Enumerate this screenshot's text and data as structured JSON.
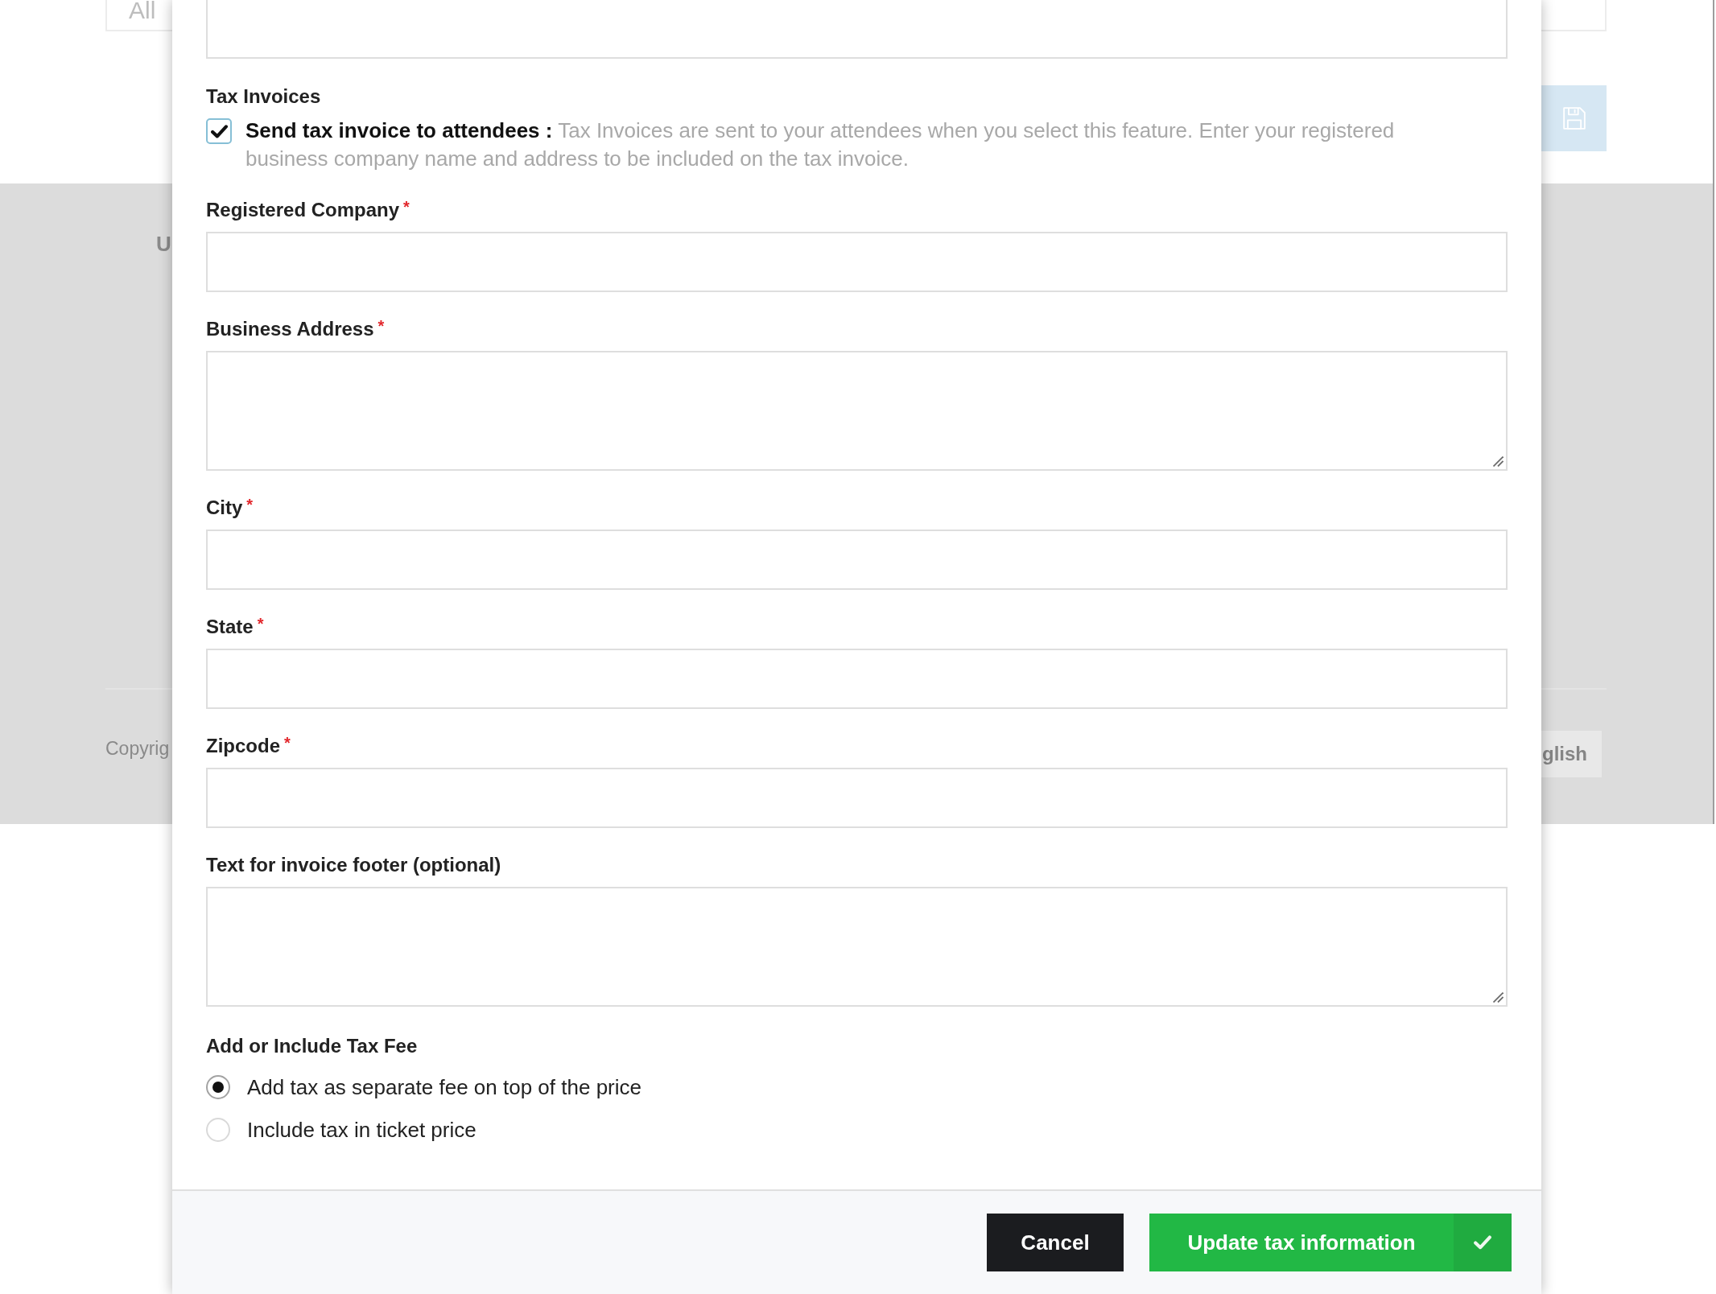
{
  "page": {
    "filter_field": {
      "placeholder": "All"
    },
    "side_heading": "U",
    "copyright": "Copyrig",
    "language_button": {
      "label": "glish"
    }
  },
  "modal": {
    "tax_invoices": {
      "heading": "Tax Invoices",
      "send_invoice": {
        "checked": true,
        "text": "**Send tax invoice to attendees :** Tax Invoices are sent to your attendees when you select this feature. Enter your registered business company name and address to be included on the tax invoice."
      }
    },
    "fields": [
      {
        "label": "Registered Company",
        "required_mark": "*",
        "kind": "input"
      },
      {
        "label": "Business Address",
        "required_mark": "*",
        "kind": "textarea"
      },
      {
        "label": "City",
        "required_mark": "*",
        "kind": "input"
      },
      {
        "label": "State",
        "required_mark": "*",
        "kind": "input"
      },
      {
        "label": "Zipcode",
        "required_mark": "*",
        "kind": "input"
      },
      {
        "label": "Text for invoice footer (optional)",
        "kind": "textarea"
      }
    ],
    "tax_fee": {
      "heading": "Add or Include Tax Fee",
      "options": [
        {
          "label": "Add tax as separate fee on top of the price",
          "selected": true
        },
        {
          "label": "Include tax in ticket price",
          "selected": false
        }
      ]
    },
    "buttons": [
      {
        "kind": "cancel",
        "label": "Cancel"
      },
      {
        "kind": "submit",
        "label": "Update tax information"
      }
    ]
  }
}
